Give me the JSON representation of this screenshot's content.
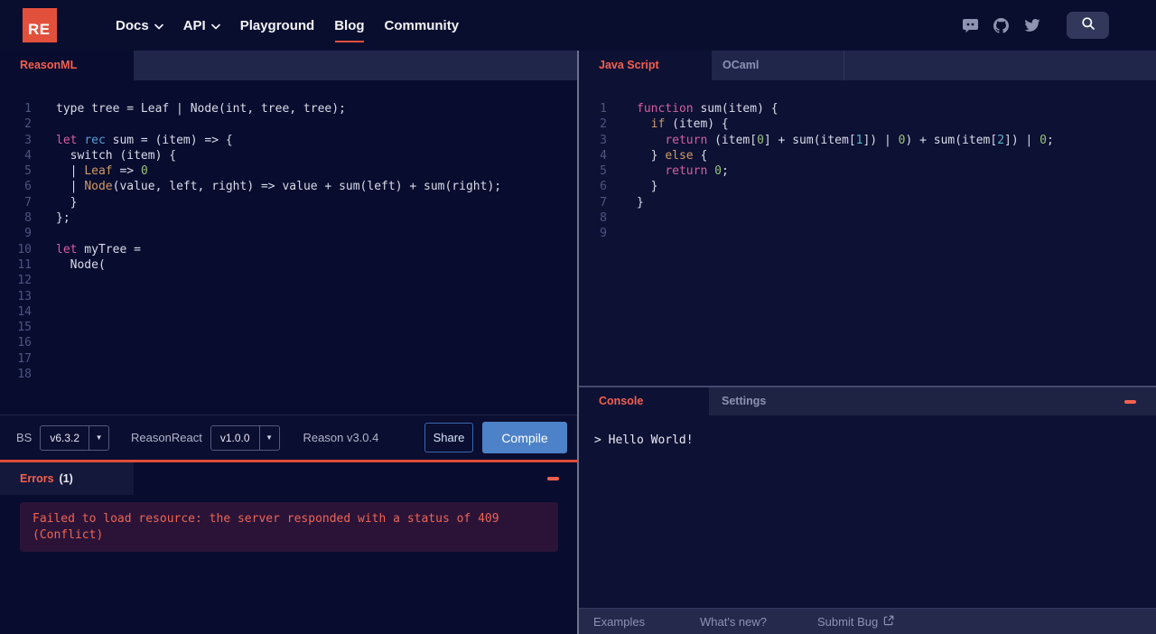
{
  "navbar": {
    "logo": "RE",
    "items": [
      {
        "label": "Docs",
        "chevron": true,
        "active": false
      },
      {
        "label": "API",
        "chevron": true,
        "active": false
      },
      {
        "label": "Playground",
        "chevron": false,
        "active": false
      },
      {
        "label": "Blog",
        "chevron": false,
        "active": true
      },
      {
        "label": "Community",
        "chevron": false,
        "active": false
      }
    ],
    "social_icons": [
      "discord-icon",
      "github-icon",
      "twitter-icon"
    ]
  },
  "left": {
    "tab": "ReasonML",
    "editor_lines": [
      [
        [
          "p",
          "type tree = Leaf | Node(int, tree, tree);"
        ]
      ],
      [],
      [
        [
          "k",
          "let"
        ],
        [
          "p",
          " "
        ],
        [
          "b",
          "rec"
        ],
        [
          "p",
          " sum = (item) => {"
        ]
      ],
      [
        [
          "p",
          "  switch (item) {"
        ]
      ],
      [
        [
          "p",
          "  | "
        ],
        [
          "o",
          "Leaf"
        ],
        [
          "p",
          " => "
        ],
        [
          "g",
          "0"
        ]
      ],
      [
        [
          "p",
          "  | "
        ],
        [
          "o",
          "Node"
        ],
        [
          "p",
          "(value, left, right) => value + sum(left) + sum(right);"
        ]
      ],
      [
        [
          "p",
          "  }"
        ]
      ],
      [
        [
          "p",
          "};"
        ]
      ],
      [],
      [
        [
          "k",
          "let"
        ],
        [
          "p",
          " myTree ="
        ]
      ],
      [
        [
          "p",
          "  Node("
        ]
      ],
      [],
      [],
      [],
      [],
      [],
      [],
      []
    ],
    "toolbar": {
      "bs_label": "BS",
      "bs_version": "v6.3.2",
      "reasonreact_label": "ReasonReact",
      "reasonreact_version": "v1.0.0",
      "reason_version": "Reason v3.0.4",
      "share": "Share",
      "compile": "Compile"
    },
    "errors": {
      "title": "Errors",
      "count": "(1)",
      "message_line1": "Failed to load resource: the server responded with a status of 409",
      "message_line2": "(Conflict)"
    }
  },
  "right": {
    "tabs": {
      "active": "Java Script",
      "inactive": "OCaml"
    },
    "editor_lines": [
      [
        [
          "k",
          "function"
        ],
        [
          "p",
          " sum(item) {"
        ]
      ],
      [
        [
          "p",
          "  "
        ],
        [
          "o",
          "if"
        ],
        [
          "p",
          " (item) {"
        ]
      ],
      [
        [
          "p",
          "    "
        ],
        [
          "k",
          "return"
        ],
        [
          "p",
          " (item["
        ],
        [
          "g",
          "0"
        ],
        [
          "p",
          "] + sum(item["
        ],
        [
          "c",
          "1"
        ],
        [
          "p",
          "]) | "
        ],
        [
          "g",
          "0"
        ],
        [
          "p",
          ") + sum(item["
        ],
        [
          "c",
          "2"
        ],
        [
          "p",
          "]) | "
        ],
        [
          "g",
          "0"
        ],
        [
          "p",
          ";"
        ]
      ],
      [
        [
          "p",
          "  } "
        ],
        [
          "o",
          "else"
        ],
        [
          "p",
          " {"
        ]
      ],
      [
        [
          "p",
          "    "
        ],
        [
          "k",
          "return"
        ],
        [
          "p",
          " "
        ],
        [
          "g",
          "0"
        ],
        [
          "p",
          ";"
        ]
      ],
      [
        [
          "p",
          "  }"
        ]
      ],
      [
        [
          "p",
          "}"
        ]
      ],
      [],
      []
    ],
    "console": {
      "tab_active": "Console",
      "tab_inactive": "Settings",
      "output": "> Hello World!"
    },
    "footer": {
      "examples": "Examples",
      "whats_new": "What's new?",
      "submit_bug": "Submit Bug"
    }
  },
  "colors": {
    "accent_red": "#f4604e",
    "brand_red": "#e2503c",
    "error_line": "#de4d37",
    "button_blue": "#4d82c8",
    "token_plain": "#d8dce8",
    "token_keyword_pink": "#d160a0",
    "token_blue": "#56a0d3",
    "token_orange": "#d19a66",
    "token_green": "#98c379",
    "token_cyan": "#56b6c2"
  }
}
